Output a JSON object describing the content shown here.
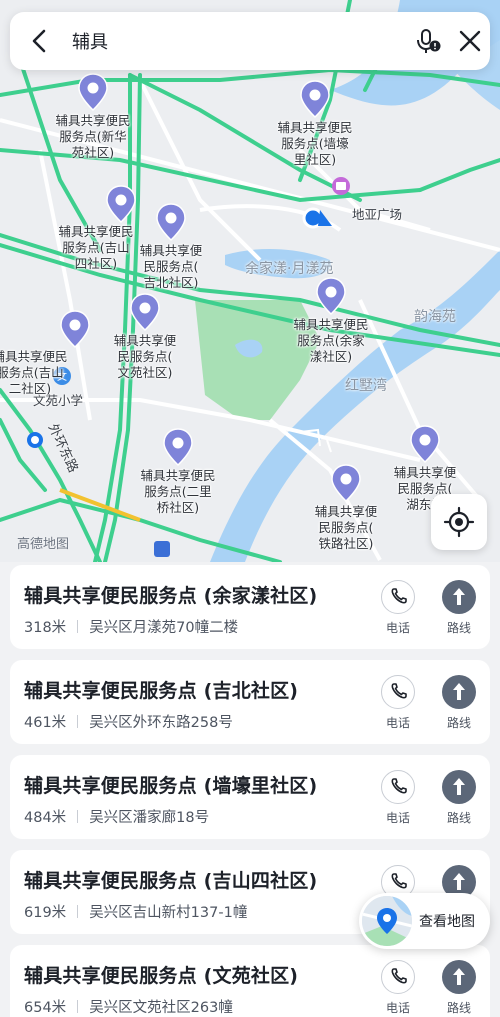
{
  "search": {
    "query": "辅具"
  },
  "map": {
    "area_labels": {
      "yujiayang": "余家漾·月漾苑",
      "yunhaiyuan": "韵海苑",
      "hongyewan": "红墅湾"
    },
    "poi_labels": {
      "plaza": "地亚广场",
      "school": "文苑小学"
    },
    "road_labels": {
      "waihuan": "外环东路"
    },
    "pins": [
      {
        "label": "辅具共享便民\n服务点(墙壕\n里社区)"
      },
      {
        "label": "辅具共享便民\n服务点(新华\n苑社区)"
      },
      {
        "label": "辅具共享便民\n服务点(吉山\n四社区)"
      },
      {
        "label": "辅具共享便\n民服务点(\n吉北社区)"
      },
      {
        "label": "辅具共享便民\n服务点(余家\n漾社区)"
      },
      {
        "label": "辅具共享便民\n服务点(吉山\n二社区)"
      },
      {
        "label": "辅具共享便\n民服务点(\n文苑社区)"
      },
      {
        "label": "辅具共享便民\n服务点(二里\n桥社区)"
      },
      {
        "label": "辅具共享便\n民服务点(\n铁路社区)"
      },
      {
        "label": "辅具共享便\n民服务点(\n湖东社"
      }
    ],
    "logo": "高德地图"
  },
  "view_map_label": "查看地图",
  "actions": {
    "phone_label": "电话",
    "route_label": "路线"
  },
  "results": [
    {
      "title": "辅具共享便民服务点 (余家漾社区)",
      "distance": "318米",
      "address": "吴兴区月漾苑70幢二楼"
    },
    {
      "title": "辅具共享便民服务点 (吉北社区)",
      "distance": "461米",
      "address": "吴兴区外环东路258号"
    },
    {
      "title": "辅具共享便民服务点 (墙壕里社区)",
      "distance": "484米",
      "address": "吴兴区潘家廊18号"
    },
    {
      "title": "辅具共享便民服务点 (吉山四社区)",
      "distance": "619米",
      "address": "吴兴区吉山新村137-1幢"
    },
    {
      "title": "辅具共享便民服务点 (文苑社区)",
      "distance": "654米",
      "address": "吴兴区文苑社区263幢"
    }
  ],
  "colors": {
    "road_green": "#3ecf8e",
    "water": "#a9d2f5",
    "park": "#a8e0b5",
    "pin_purple": "#7f84d9",
    "accent_blue": "#1a73e8"
  }
}
